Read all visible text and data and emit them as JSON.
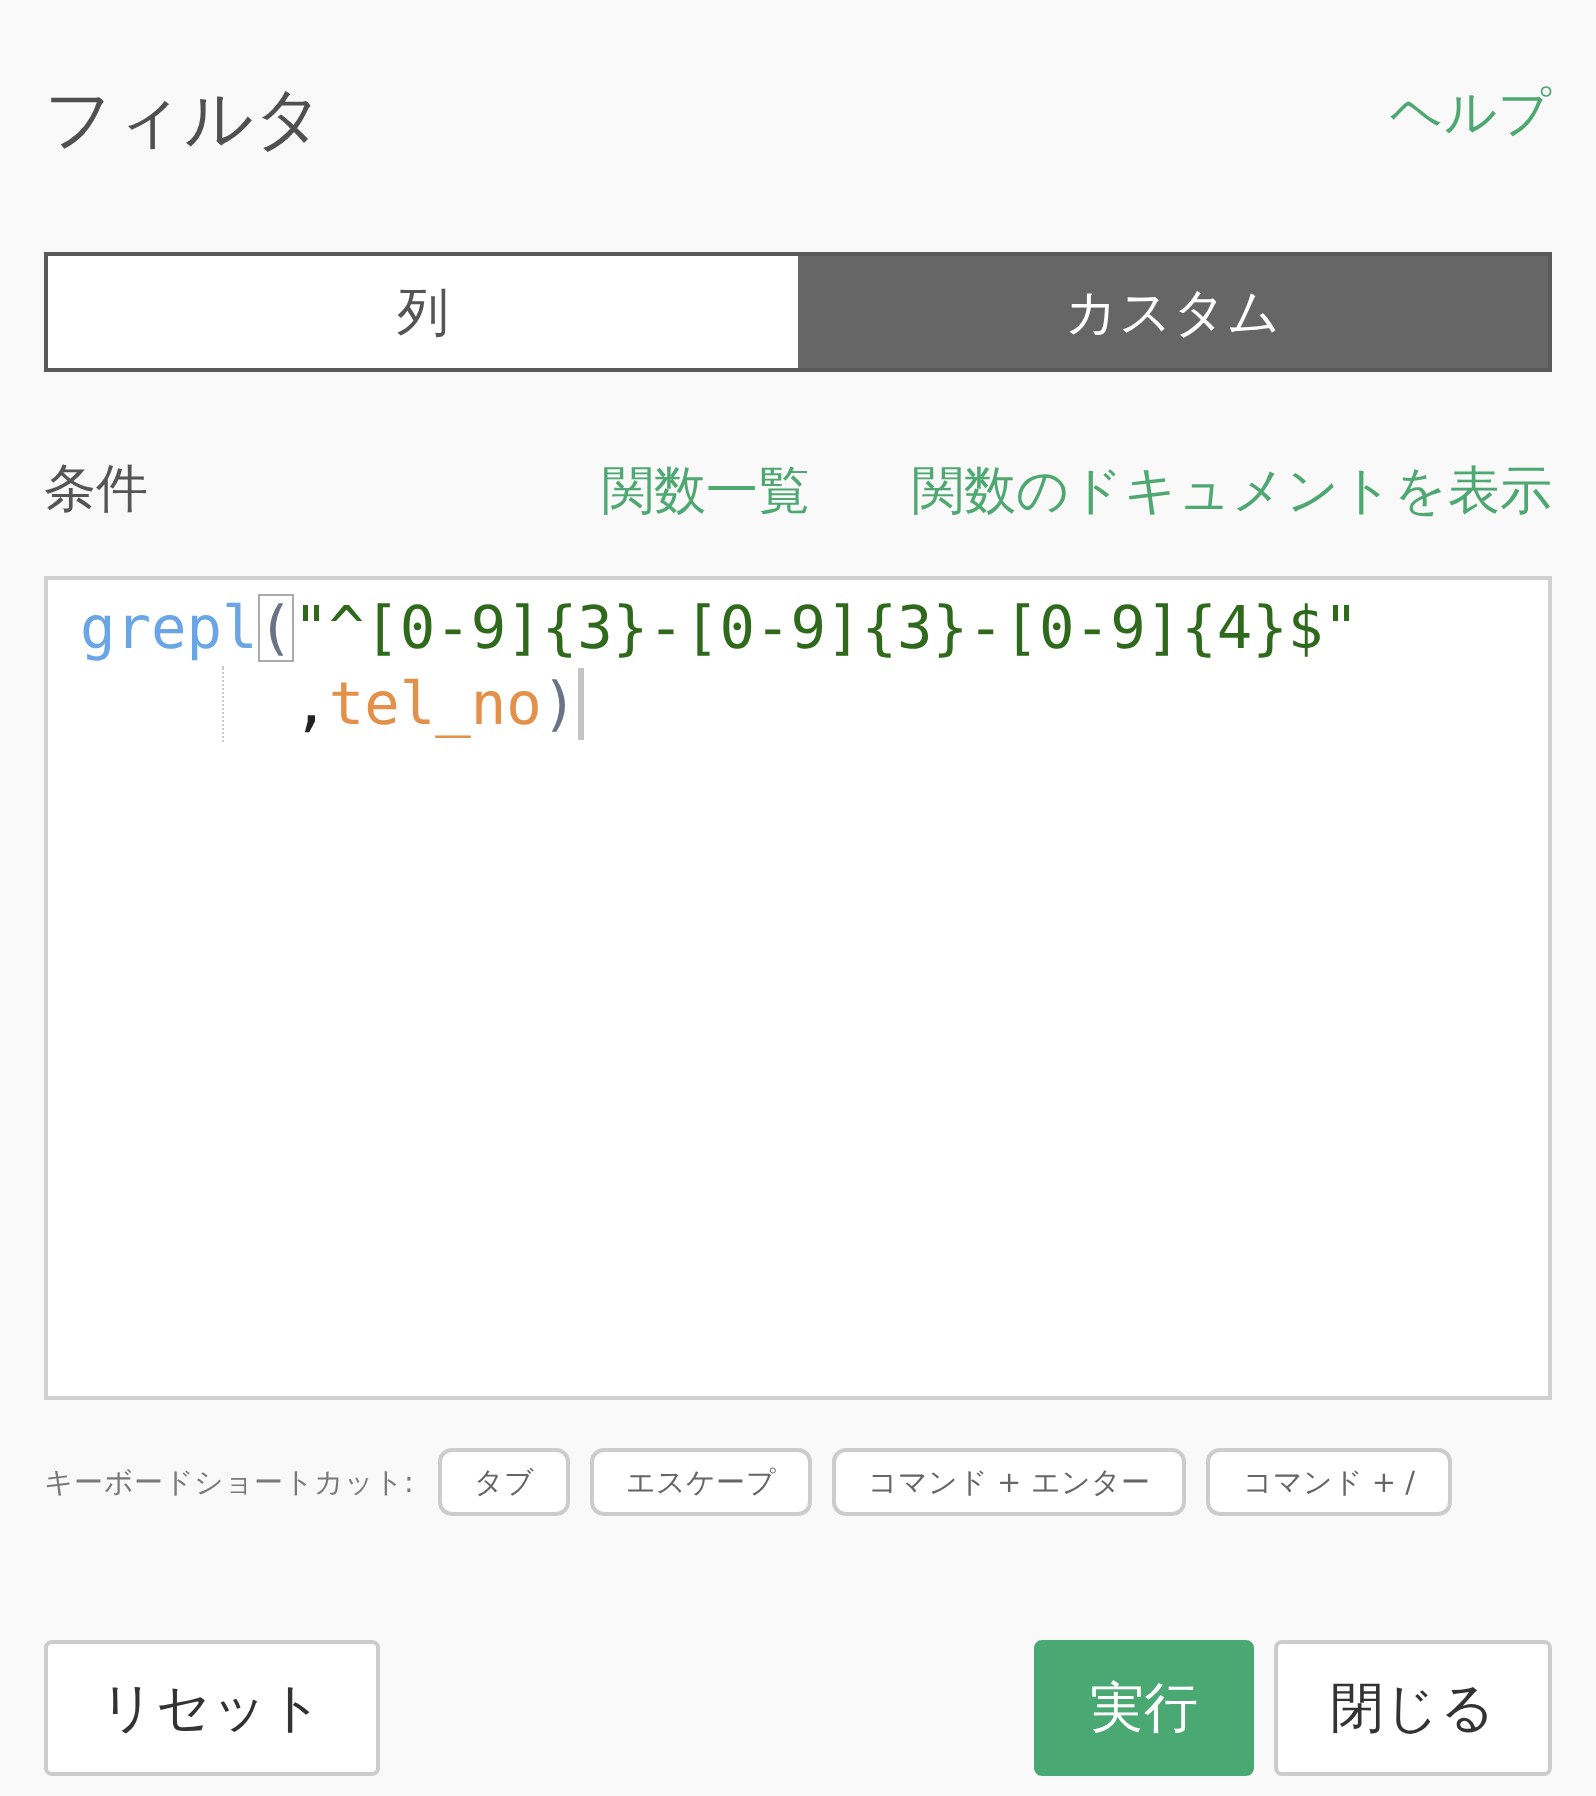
{
  "title": "フィルタ",
  "help_link": "ヘルプ",
  "tabs": [
    {
      "label": "列",
      "selected": false
    },
    {
      "label": "カスタム",
      "selected": true
    }
  ],
  "condition": {
    "label": "条件",
    "links": [
      "関数一覧",
      "関数のドキュメントを表示"
    ]
  },
  "editor": {
    "lines": [
      {
        "kind": "first",
        "tokens": [
          {
            "kind": "function",
            "text": "grepl",
            "highlighted": false,
            "cursor": false
          },
          {
            "kind": "bracket",
            "text": "(",
            "highlighted": true,
            "cursor": false
          },
          {
            "kind": "string",
            "text": "\"^[0-9]{3}-[0-9]{3}-[0-9]{4}$\"",
            "highlighted": false,
            "cursor": false
          }
        ]
      },
      {
        "kind": "wrapped",
        "tokens": [
          {
            "kind": "punctuation",
            "text": ",",
            "highlighted": false,
            "cursor": false
          },
          {
            "kind": "variable",
            "text": "tel_no",
            "highlighted": false,
            "cursor": false
          },
          {
            "kind": "bracket",
            "text": ")",
            "highlighted": false,
            "cursor": true
          }
        ]
      }
    ]
  },
  "shortcuts": {
    "label": "キーボードショートカット:",
    "keys": [
      "タブ",
      "エスケープ",
      "コマンド + エンター",
      "コマンド + /"
    ]
  },
  "left_buttons": [
    {
      "label": "リセット",
      "kind": "secondary"
    }
  ],
  "right_buttons": [
    {
      "label": "実行",
      "kind": "primary"
    },
    {
      "label": "閉じる",
      "kind": "secondary"
    }
  ]
}
